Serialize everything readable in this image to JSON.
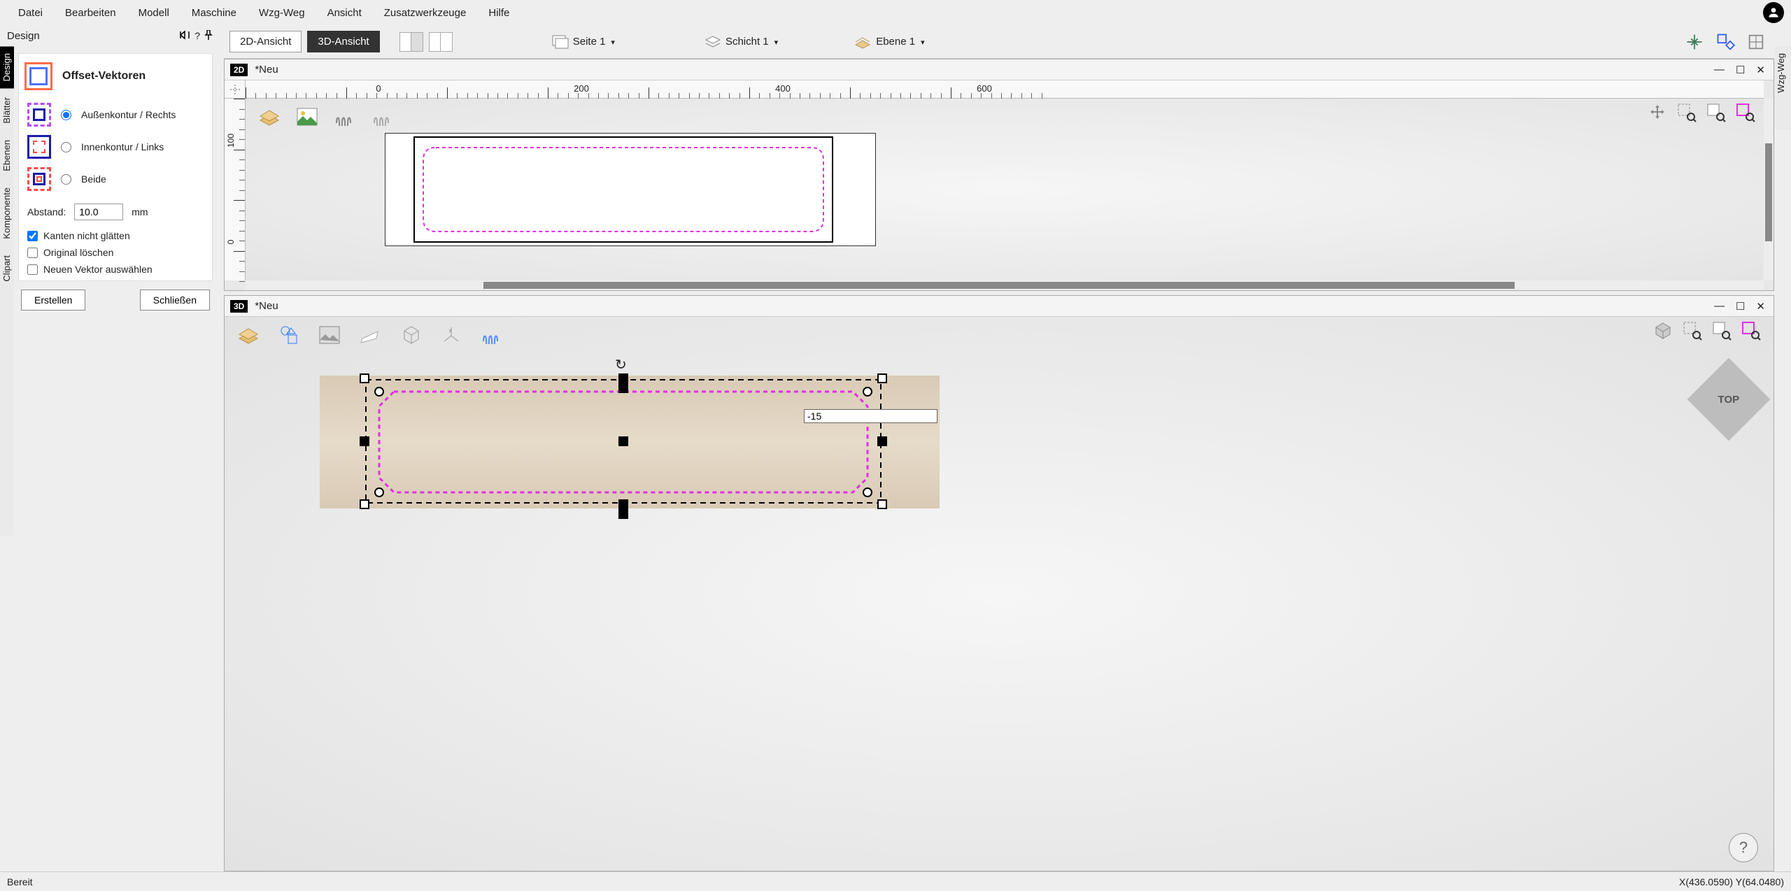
{
  "menubar": {
    "items": [
      "Datei",
      "Bearbeiten",
      "Modell",
      "Maschine",
      "Wzg-Weg",
      "Ansicht",
      "Zusatzwerkzeuge",
      "Hilfe"
    ]
  },
  "design_titlebar": {
    "title": "Design"
  },
  "left_tabs": [
    "Design",
    "Blätter",
    "Ebenen",
    "Komponente",
    "Clipart"
  ],
  "right_tabs": [
    "Wzg-Weg"
  ],
  "panel": {
    "title": "Offset-Vektoren",
    "options": [
      {
        "label": "Außenkontur / Rechts",
        "checked": true
      },
      {
        "label": "Innenkontur / Links",
        "checked": false
      },
      {
        "label": "Beide",
        "checked": false
      }
    ],
    "distance_label": "Abstand:",
    "distance_value": "10.0",
    "distance_unit": "mm",
    "checks": [
      {
        "label": "Kanten nicht glätten",
        "checked": true
      },
      {
        "label": "Original löschen",
        "checked": false
      },
      {
        "label": "Neuen Vektor auswählen",
        "checked": false
      }
    ],
    "buttons": {
      "create": "Erstellen",
      "close": "Schließen"
    }
  },
  "toolbar": {
    "view2d": "2D-Ansicht",
    "view3d": "3D-Ansicht",
    "seite": "Seite 1",
    "schicht": "Schicht 1",
    "ebene": "Ebene 1"
  },
  "vp2d": {
    "badge": "2D",
    "title": "*Neu",
    "ruler_h": [
      "0",
      "200",
      "400",
      "600"
    ],
    "ruler_v": [
      "100",
      "0"
    ]
  },
  "vp3d": {
    "badge": "3D",
    "title": "*Neu",
    "input_value": "-15",
    "top_label": "TOP"
  },
  "statusbar": {
    "left": "Bereit",
    "right": "X(436.0590) Y(64.0480)"
  }
}
